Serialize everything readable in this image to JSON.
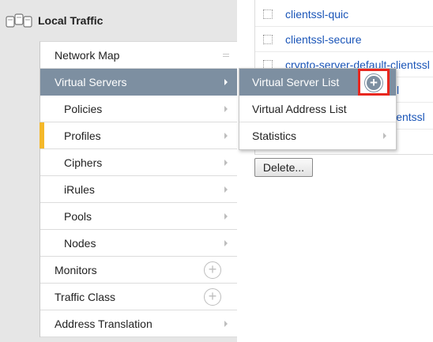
{
  "section": {
    "title": "Local Traffic",
    "icon": "local-traffic-icon"
  },
  "main_menu": [
    {
      "label": "Network Map",
      "icon": "grip-icon"
    },
    {
      "label": "Virtual Servers",
      "icon": "chevron-right-icon",
      "state": "active"
    },
    {
      "label": "Policies",
      "icon": "chevron-right-icon"
    },
    {
      "label": "Profiles",
      "icon": "chevron-right-icon",
      "marker_color": "#f4b82a"
    },
    {
      "label": "Ciphers",
      "icon": "chevron-right-icon"
    },
    {
      "label": "iRules",
      "icon": "chevron-right-icon"
    },
    {
      "label": "Pools",
      "icon": "chevron-right-icon"
    },
    {
      "label": "Nodes",
      "icon": "chevron-right-icon"
    },
    {
      "label": "Monitors",
      "icon": "plus-circle-icon"
    },
    {
      "label": "Traffic Class",
      "icon": "plus-circle-icon"
    },
    {
      "label": "Address Translation",
      "icon": "chevron-right-icon"
    }
  ],
  "flyout_menu": [
    {
      "label": "Virtual Server List",
      "icon": "add-circle-icon",
      "state": "active"
    },
    {
      "label": "Virtual Address List"
    },
    {
      "label": "Statistics",
      "icon": "chevron-right-icon"
    }
  ],
  "profile_links": [
    {
      "label": "clientssl-quic"
    },
    {
      "label": "clientssl-secure"
    },
    {
      "label": "crypto-server-default-clientssl"
    },
    {
      "label": "sl"
    },
    {
      "label": "lientssl"
    }
  ],
  "delete_button": {
    "label": "Delete..."
  },
  "colors": {
    "active_bg": "#7d8fa1",
    "highlight_border": "#e8271f",
    "link": "#1a55b8",
    "marker": "#f4b82a"
  }
}
